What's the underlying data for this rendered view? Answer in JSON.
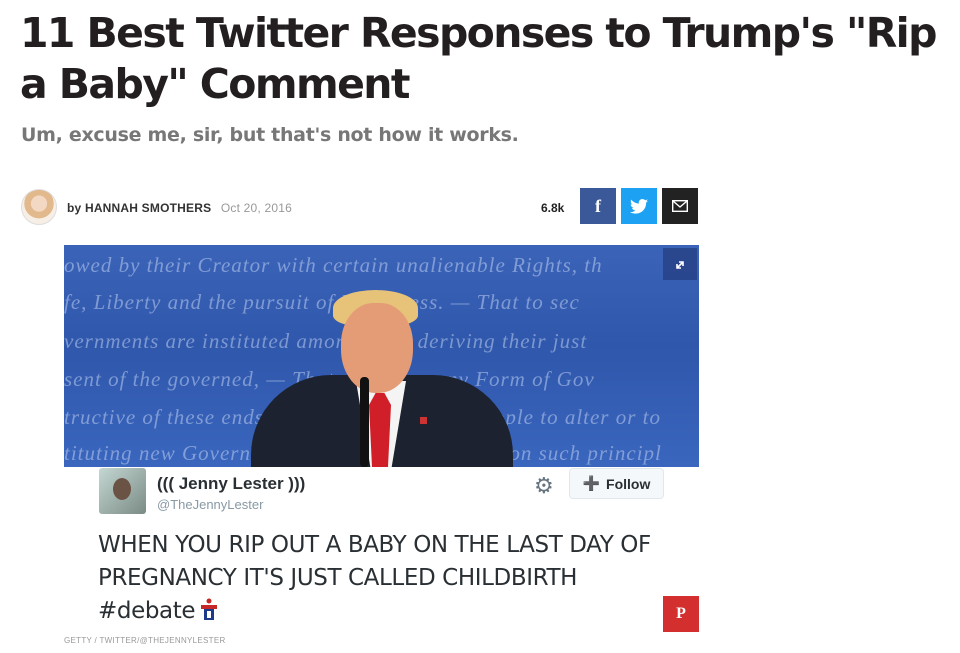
{
  "article": {
    "title": "11 Best Twitter Responses to Trump's \"Rip a Baby\" Comment",
    "subtitle": "Um, excuse me, sir, but that's not how it works.",
    "byline_prefix": "by",
    "author": "HANNAH SMOTHERS",
    "date": "Oct 20, 2016",
    "share_count": "6.8k",
    "share_facebook_icon": "f",
    "pinterest_icon": "P",
    "photo_credit": "GETTY / TWITTER/@THEJENNYLESTER"
  },
  "photo": {
    "background_lines": [
      "owed by their Creator with certain unalienable Rights, th",
      "fe, Liberty and the pursuit of Happiness. — That to sec",
      "vernments are instituted among Men, deriving their just",
      "sent of the governed, — That whenever any Form of Gov",
      "tructive of these ends, it is the Right of the People to alter or to",
      "tituting new Government, laying its foundation on such principl"
    ]
  },
  "tweet": {
    "display_name": "((( Jenny Lester )))",
    "handle": "@TheJennyLester",
    "follow_label": "Follow",
    "follow_icon": "➕",
    "text": "WHEN YOU RIP OUT A BABY ON THE LAST DAY OF PREGNANCY IT'S JUST CALLED CHILDBIRTH #debate"
  },
  "colors": {
    "facebook": "#3b5998",
    "twitter": "#1da1f2",
    "pinterest": "#d32f2f",
    "stage_blue": "#2f57ab"
  }
}
